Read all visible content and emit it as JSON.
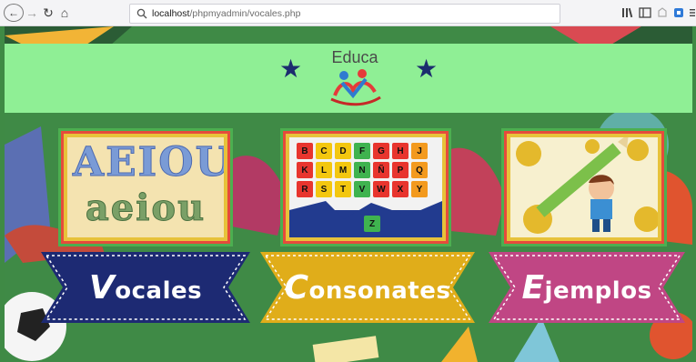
{
  "browser": {
    "url_host": "localhost",
    "url_path": "/phpmyadmin/vocales.php"
  },
  "header": {
    "title": "Educa"
  },
  "cards": {
    "vowels": {
      "upper": "AEIOU",
      "lower": "aeiou"
    },
    "consonants": {
      "letters": [
        "B",
        "C",
        "D",
        "F",
        "G",
        "H",
        "J",
        "K",
        "L",
        "M",
        "N",
        "Ñ",
        "P",
        "Q",
        "R",
        "S",
        "T",
        "V",
        "W",
        "X",
        "Y"
      ],
      "last_letter": "Z"
    }
  },
  "buttons": {
    "vowels": {
      "cap": "V",
      "rest": "ocales",
      "color": "#1d2a73"
    },
    "consonants": {
      "cap": "C",
      "rest": "onsonates",
      "color": "#e0ad1a"
    },
    "examples": {
      "cap": "E",
      "rest": "jemplos",
      "color": "#c04684"
    }
  },
  "colors": {
    "header_band": "#8fef95",
    "tiles": [
      "#e8352e",
      "#f3c70f",
      "#f3c70f",
      "#3fb34f",
      "#e8352e",
      "#e8352e",
      "#f39a1e"
    ]
  }
}
